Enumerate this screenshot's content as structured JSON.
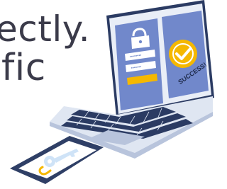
{
  "text_lines": [
    "ectly.",
    "fic"
  ],
  "success_badge": {
    "label": "SUCCESS!"
  },
  "login_form": {
    "username_mask": "••••••••",
    "password_mask": "•••••••",
    "icons": [
      "lock-icon",
      "key-icon"
    ]
  },
  "colors": {
    "text": "#3b3b4a",
    "laptop_body": "#dfe6f2",
    "laptop_dark": "#2b3b63",
    "screen_blue": "#6e86c9",
    "accent_yellow": "#f5b800",
    "phone_body": "#2f3f66",
    "key_light": "#cfe3f7"
  }
}
